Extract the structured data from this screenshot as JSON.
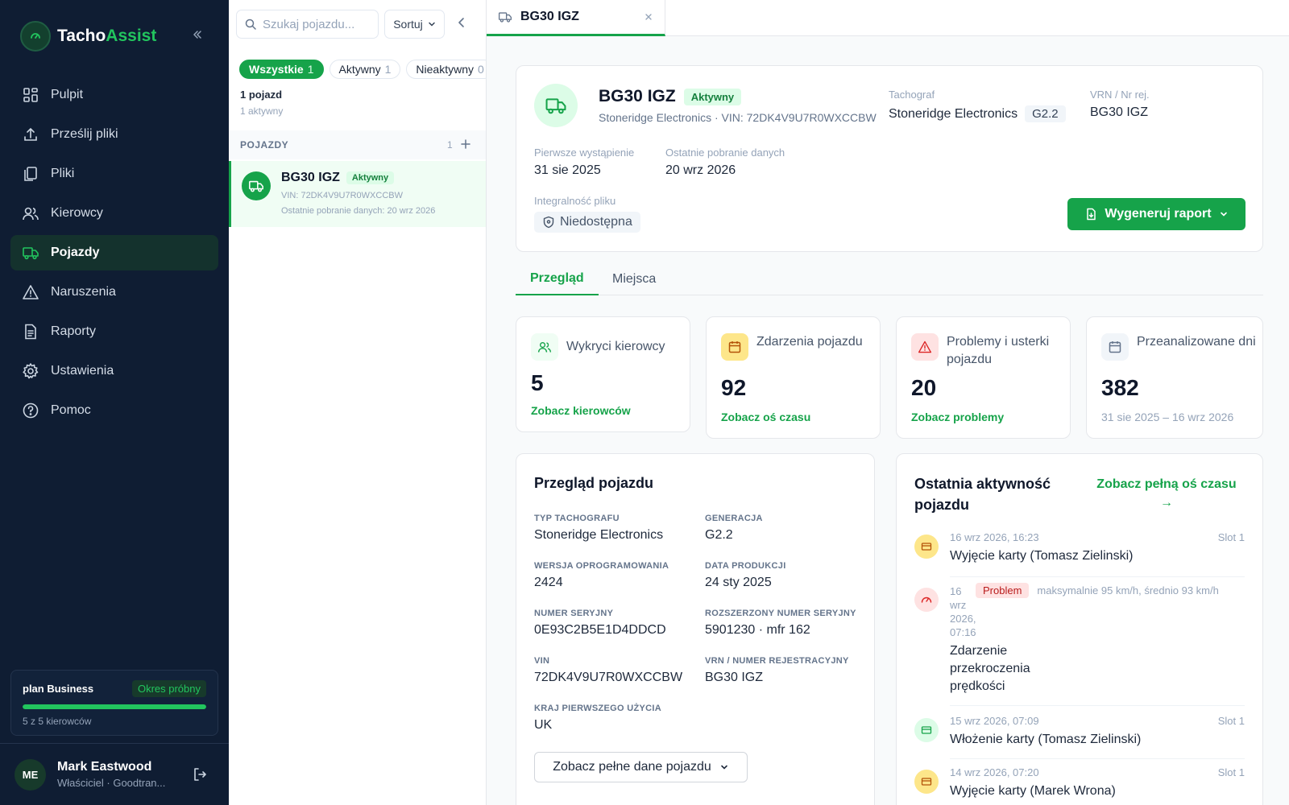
{
  "brand": {
    "name_main": "Tacho",
    "name_accent": "Assist"
  },
  "nav": [
    {
      "label": "Pulpit",
      "icon": "grid-icon"
    },
    {
      "label": "Prześlij pliki",
      "icon": "upload-icon"
    },
    {
      "label": "Pliki",
      "icon": "files-icon"
    },
    {
      "label": "Kierowcy",
      "icon": "users-icon"
    },
    {
      "label": "Pojazdy",
      "icon": "truck-icon",
      "active": true
    },
    {
      "label": "Naruszenia",
      "icon": "warning-icon"
    },
    {
      "label": "Raporty",
      "icon": "report-icon"
    },
    {
      "label": "Ustawienia",
      "icon": "gear-icon"
    },
    {
      "label": "Pomoc",
      "icon": "help-icon"
    }
  ],
  "plan": {
    "name": "plan Business",
    "badge": "Okres próbny",
    "usage_text": "5 z 5 kierowców",
    "usage_fraction": 1.0
  },
  "user": {
    "initials": "ME",
    "name": "Mark Eastwood",
    "role": "Właściciel · Goodtran..."
  },
  "list": {
    "search_placeholder": "Szukaj pojazdu...",
    "sort_label": "Sortuj",
    "filters": [
      {
        "label": "Wszystkie",
        "count": "1",
        "active": true
      },
      {
        "label": "Aktywny",
        "count": "1"
      },
      {
        "label": "Nieaktywny",
        "count": "0"
      }
    ],
    "count_text": "1 pojazd",
    "active_text": "1 aktywny",
    "group_label": "POJAZDY",
    "group_count": "1",
    "vehicle": {
      "plate": "BG30 IGZ",
      "status": "Aktywny",
      "vin": "VIN: 72DK4V9U7R0WXCCBW",
      "last_download": "Ostatnie pobranie danych: 20 wrz 2026"
    }
  },
  "doc_tab": {
    "label": "BG30 IGZ"
  },
  "header": {
    "plate": "BG30 IGZ",
    "status": "Aktywny",
    "subtitle": "Stoneridge Electronics · VIN: 72DK4V9U7R0WXCCBW",
    "tachograph_label": "Tachograf",
    "tachograph_value": "Stoneridge Electronics",
    "generation": "G2.2",
    "vrn_label": "VRN / Nr rej.",
    "vrn_value": "BG30 IGZ",
    "first_seen_label": "Pierwsze wystąpienie",
    "first_seen_value": "31 sie 2025",
    "last_download_label": "Ostatnie pobranie danych",
    "last_download_value": "20 wrz 2026",
    "integrity_label": "Integralność pliku",
    "integrity_value": "Niedostępna",
    "report_button": "Wygeneruj raport"
  },
  "tabs": [
    {
      "label": "Przegląd",
      "active": true
    },
    {
      "label": "Miejsca"
    }
  ],
  "stats": [
    {
      "label": "Wykryci kierowcy",
      "value": "5",
      "link": "Zobacz kierowców"
    },
    {
      "label": "Zdarzenia pojazdu",
      "value": "92",
      "link": "Zobacz oś czasu"
    },
    {
      "label": "Problemy i usterki pojazdu",
      "value": "20",
      "link": "Zobacz problemy"
    },
    {
      "label": "Przeanalizowane dni",
      "value": "382",
      "sub": "31 sie 2025 – 16 wrz 2026"
    }
  ],
  "overview": {
    "title": "Przegląd pojazdu",
    "fields": [
      {
        "label": "TYP TACHOGRAFU",
        "value": "Stoneridge Electronics"
      },
      {
        "label": "GENERACJA",
        "value": "G2.2"
      },
      {
        "label": "WERSJA OPROGRAMOWANIA",
        "value": "2424"
      },
      {
        "label": "DATA PRODUKCJI",
        "value": "24 sty 2025"
      },
      {
        "label": "NUMER SERYJNY",
        "value": "0E93C2B5E1D4DDCD"
      },
      {
        "label": "ROZSZERZONY NUMER SERYJNY",
        "value": "5901230 · mfr 162"
      },
      {
        "label": "VIN",
        "value": "72DK4V9U7R0WXCCBW"
      },
      {
        "label": "VRN / NUMER REJESTRACYJNY",
        "value": "BG30 IGZ"
      },
      {
        "label": "KRAJ PIERWSZEGO UŻYCIA",
        "value": "UK"
      }
    ],
    "button": "Zobacz pełne dane pojazdu"
  },
  "activity": {
    "title": "Ostatnia aktywność pojazdu",
    "link": "Zobacz pełną oś czasu →",
    "events": [
      {
        "date": "16 wrz 2026, 16:23",
        "title": "Wyjęcie karty (Tomasz Zielinski)",
        "slot": "Slot 1",
        "icon": "card-icon"
      },
      {
        "date": "16 wrz 2026, 07:16",
        "badge": "Problem",
        "detail": "maksymalnie 95 km/h, średnio 93 km/h",
        "title": "Zdarzenie przekroczenia prędkości",
        "icon": "speedometer-icon"
      },
      {
        "date": "15 wrz 2026, 07:09",
        "title": "Włożenie karty (Tomasz Zielinski)",
        "slot": "Slot 1",
        "icon": "card-icon"
      },
      {
        "date": "14 wrz 2026, 07:20",
        "title": "Wyjęcie karty (Marek Wrona)",
        "slot": "Slot 1",
        "icon": "card-icon"
      }
    ]
  },
  "colors": {
    "accent": "#16a34a",
    "sidebar": "#0f1d33",
    "danger": "#b91c1c",
    "warning": "#d97706"
  }
}
